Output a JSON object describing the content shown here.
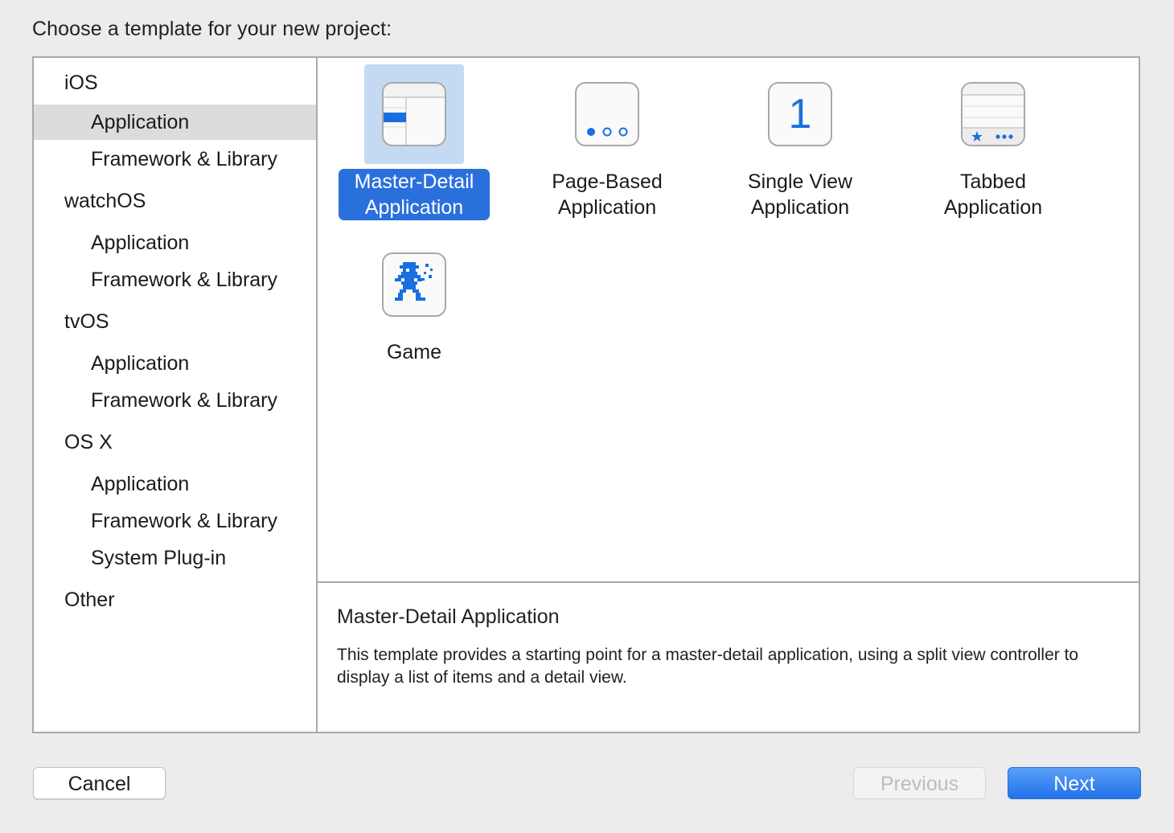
{
  "prompt": "Choose a template for your new project:",
  "sidebar": {
    "rows": [
      {
        "label": "iOS",
        "kind": "platform"
      },
      {
        "label": "Application",
        "kind": "category",
        "selected": true
      },
      {
        "label": "Framework & Library",
        "kind": "category"
      },
      {
        "label": "watchOS",
        "kind": "platform"
      },
      {
        "label": "Application",
        "kind": "category"
      },
      {
        "label": "Framework & Library",
        "kind": "category"
      },
      {
        "label": "tvOS",
        "kind": "platform"
      },
      {
        "label": "Application",
        "kind": "category"
      },
      {
        "label": "Framework & Library",
        "kind": "category"
      },
      {
        "label": "OS X",
        "kind": "platform"
      },
      {
        "label": "Application",
        "kind": "category"
      },
      {
        "label": "Framework & Library",
        "kind": "category"
      },
      {
        "label": "System Plug-in",
        "kind": "category"
      },
      {
        "label": "Other",
        "kind": "platform"
      }
    ]
  },
  "templates": [
    {
      "line1": "Master-Detail",
      "line2": "Application",
      "icon": "master-detail-icon",
      "selected": true
    },
    {
      "line1": "Page-Based",
      "line2": "Application",
      "icon": "page-dots-icon"
    },
    {
      "line1": "Single View",
      "line2": "Application",
      "icon": "single-view-icon",
      "icon_text": "1"
    },
    {
      "line1": "Tabbed",
      "line2": "Application",
      "icon": "tab-bar-icon"
    },
    {
      "line1": "Game",
      "line2": "",
      "icon": "game-robot-icon"
    }
  ],
  "details": {
    "title": "Master-Detail Application",
    "description": "This template provides a starting point for a master-detail application, using a split view controller to display a list of items and a detail view."
  },
  "buttons": {
    "cancel": "Cancel",
    "previous": "Previous",
    "next": "Next"
  },
  "colors": {
    "accent": "#2a70dd",
    "selection_bg": "#c4daf3",
    "sidebar_selected": "#dcdcdc",
    "icon_blue": "#1a6fe0"
  }
}
